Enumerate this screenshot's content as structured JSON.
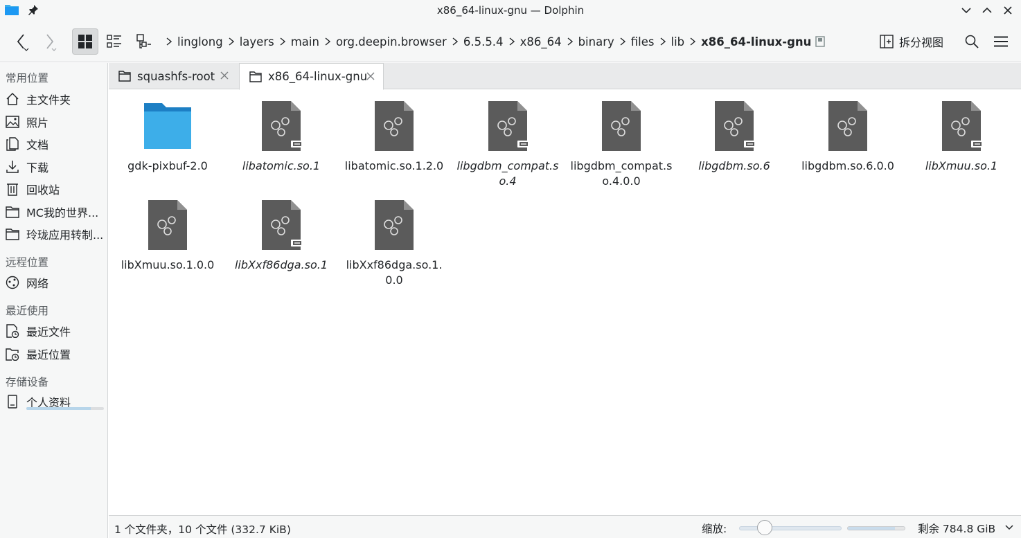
{
  "window": {
    "title": "x86_64-linux-gnu — Dolphin"
  },
  "toolbar": {
    "breadcrumbs": [
      "linglong",
      "layers",
      "main",
      "org.deepin.browser",
      "6.5.5.4",
      "x86_64",
      "binary",
      "files",
      "lib",
      "x86_64-linux-gnu"
    ],
    "split_label": "拆分视图"
  },
  "sidebar": {
    "sections": [
      "常用位置",
      "远程位置",
      "最近使用",
      "存储设备"
    ],
    "places": [
      {
        "label": "主文件夹",
        "icon": "home-icon"
      },
      {
        "label": "照片",
        "icon": "image-icon"
      },
      {
        "label": "文档",
        "icon": "document-icon"
      },
      {
        "label": "下载",
        "icon": "download-icon"
      },
      {
        "label": "回收站",
        "icon": "trash-icon"
      },
      {
        "label": "MC我的世界...",
        "icon": "folder-icon"
      },
      {
        "label": "玲珑应用转制...",
        "icon": "folder-icon"
      }
    ],
    "remote": [
      {
        "label": "网络",
        "icon": "network-icon"
      }
    ],
    "recent": [
      {
        "label": "最近文件",
        "icon": "recent-files-icon"
      },
      {
        "label": "最近位置",
        "icon": "recent-locations-icon"
      }
    ],
    "devices": [
      {
        "label": "个人资料",
        "icon": "drive-icon",
        "usage": 0.83
      }
    ]
  },
  "tabs": [
    {
      "label": "squashfs-root",
      "active": false
    },
    {
      "label": "x86_64-linux-gnu",
      "active": true
    }
  ],
  "files": [
    {
      "name": "gdk-pixbuf-2.0",
      "type": "folder",
      "symlink": false
    },
    {
      "name": "libatomic.so.1",
      "type": "library",
      "symlink": true
    },
    {
      "name": "libatomic.so.1.2.0",
      "type": "library",
      "symlink": false
    },
    {
      "name": "libgdbm_compat.so.4",
      "type": "library",
      "symlink": true
    },
    {
      "name": "libgdbm_compat.so.4.0.0",
      "type": "library",
      "symlink": false
    },
    {
      "name": "libgdbm.so.6",
      "type": "library",
      "symlink": true
    },
    {
      "name": "libgdbm.so.6.0.0",
      "type": "library",
      "symlink": false
    },
    {
      "name": "libXmuu.so.1",
      "type": "library",
      "symlink": true
    },
    {
      "name": "libXmuu.so.1.0.0",
      "type": "library",
      "symlink": false
    },
    {
      "name": "libXxf86dga.so.1",
      "type": "library",
      "symlink": true
    },
    {
      "name": "libXxf86dga.so.1.0.0",
      "type": "library",
      "symlink": false
    }
  ],
  "status": {
    "summary": "1 个文件夹，10 个文件 (332.7 KiB)",
    "zoom_label": "缩放:",
    "zoom_level": 0.25,
    "free_space": "剩余 784.8 GiB",
    "used_fraction": 0.83
  }
}
